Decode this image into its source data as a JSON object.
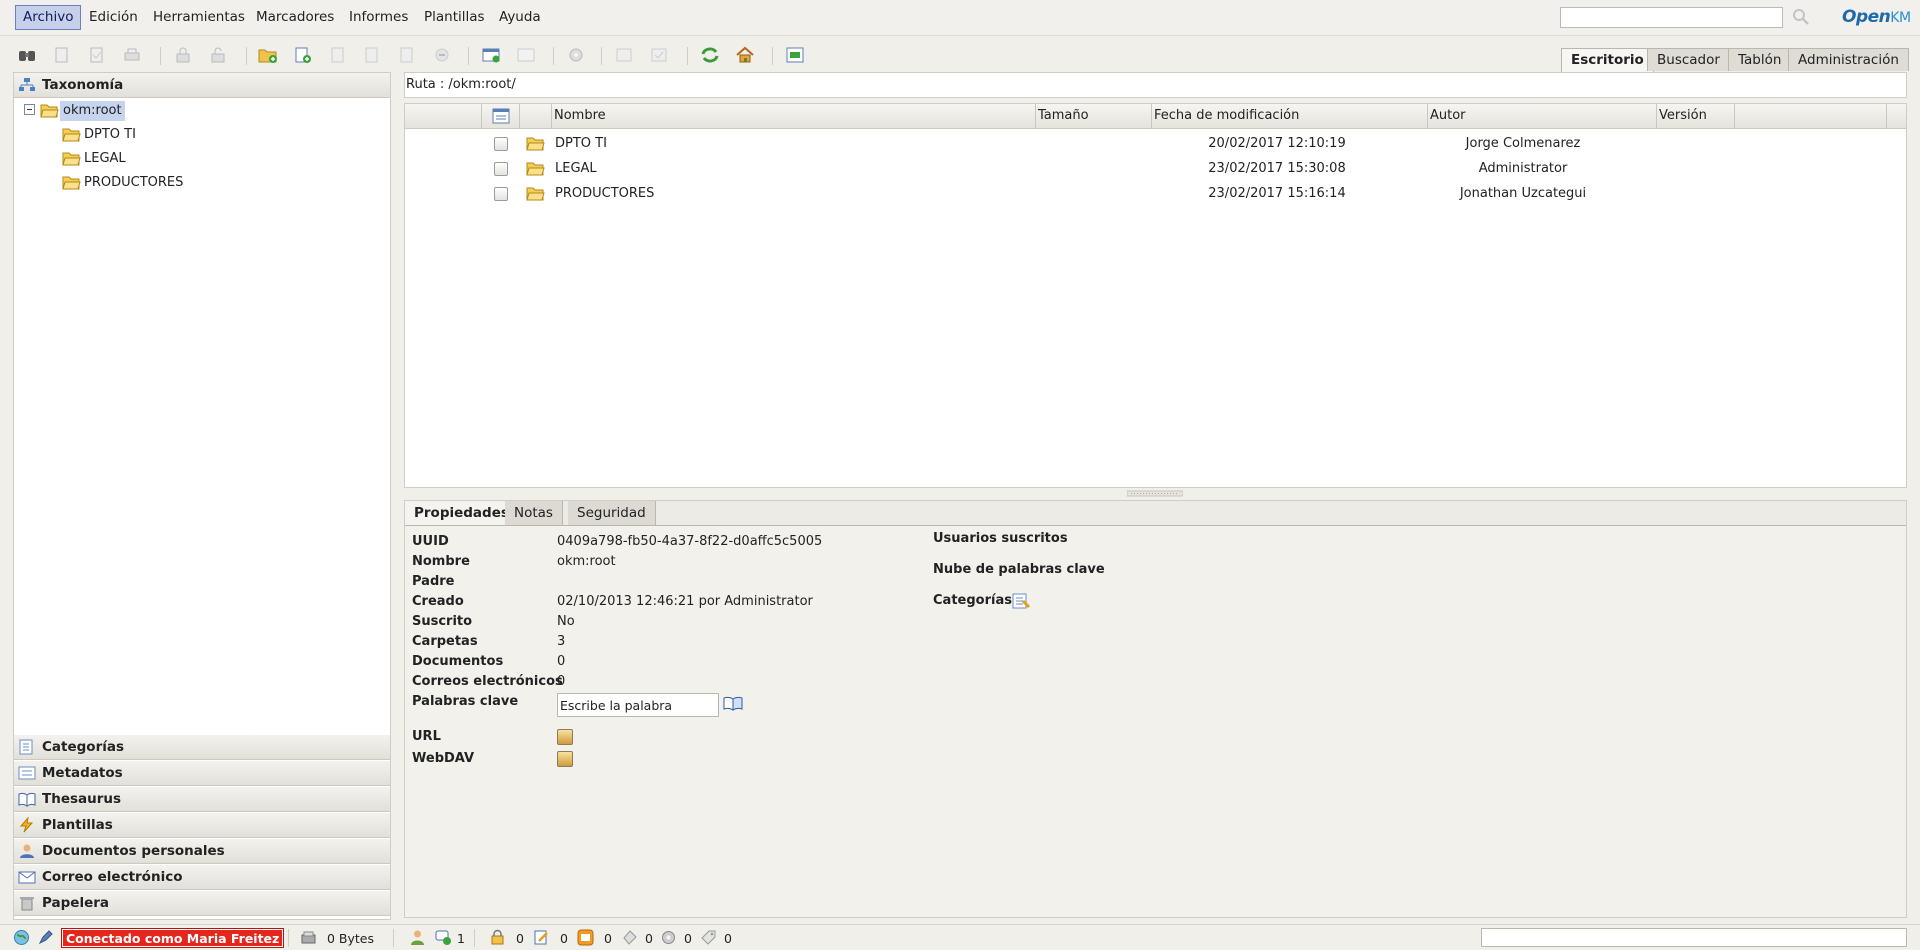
{
  "menu": {
    "items": [
      {
        "label": "Archivo",
        "active": true
      },
      {
        "label": "Edición"
      },
      {
        "label": "Herramientas"
      },
      {
        "label": "Marcadores"
      },
      {
        "label": "Informes"
      },
      {
        "label": "Plantillas"
      },
      {
        "label": "Ayuda"
      }
    ]
  },
  "brand": {
    "open": "Open",
    "km": "KM"
  },
  "workspace_tabs": [
    "Escritorio",
    "Buscador",
    "Tablón",
    "Administración"
  ],
  "left": {
    "taxonomy_header": "Taxonomía",
    "tree": {
      "root": "okm:root",
      "children": [
        "DPTO TI",
        "LEGAL",
        "PRODUCTORES"
      ]
    },
    "stack": [
      "Categorías",
      "Metadatos",
      "Thesaurus",
      "Plantillas",
      "Documentos personales",
      "Correo electrónico",
      "Papelera"
    ]
  },
  "breadcrumb": "Ruta : /okm:root/",
  "browser": {
    "columns": [
      "Nombre",
      "Tamaño",
      "Fecha de modificación",
      "Autor",
      "Versión"
    ],
    "rows": [
      {
        "name": "DPTO TI",
        "date": "20/02/2017 12:10:19",
        "author": "Jorge Colmenarez"
      },
      {
        "name": "LEGAL",
        "date": "23/02/2017 15:30:08",
        "author": "Administrator"
      },
      {
        "name": "PRODUCTORES",
        "date": "23/02/2017 15:16:14",
        "author": "Jonathan Uzcategui"
      }
    ]
  },
  "properties": {
    "tabs": [
      "Propiedades",
      "Notas",
      "Seguridad"
    ],
    "labels": {
      "uuid": "UUID",
      "name": "Nombre",
      "parent": "Padre",
      "created": "Creado",
      "subscribed": "Suscrito",
      "folders": "Carpetas",
      "documents": "Documentos",
      "mails": "Correos electrónicos",
      "keywords": "Palabras clave",
      "url": "URL",
      "webdav": "WebDAV"
    },
    "values": {
      "uuid": "0409a798-fb50-4a37-8f22-d0affc5c5005",
      "name": "okm:root",
      "parent": "",
      "created": "02/10/2013 12:46:21 por Administrator",
      "subscribed": "No",
      "folders": "3",
      "documents": "0",
      "mails": "0"
    },
    "keyword_input": "Escribe la palabra",
    "right_labels": {
      "subscribers": "Usuarios suscritos",
      "keyword_cloud": "Nube de palabras clave",
      "categories": "Categorías"
    }
  },
  "status": {
    "connected": "Conectado como Maria Freitez",
    "size": "0 Bytes",
    "counters": [
      "1",
      "0",
      "0",
      "0",
      "0",
      "0",
      "0"
    ]
  }
}
